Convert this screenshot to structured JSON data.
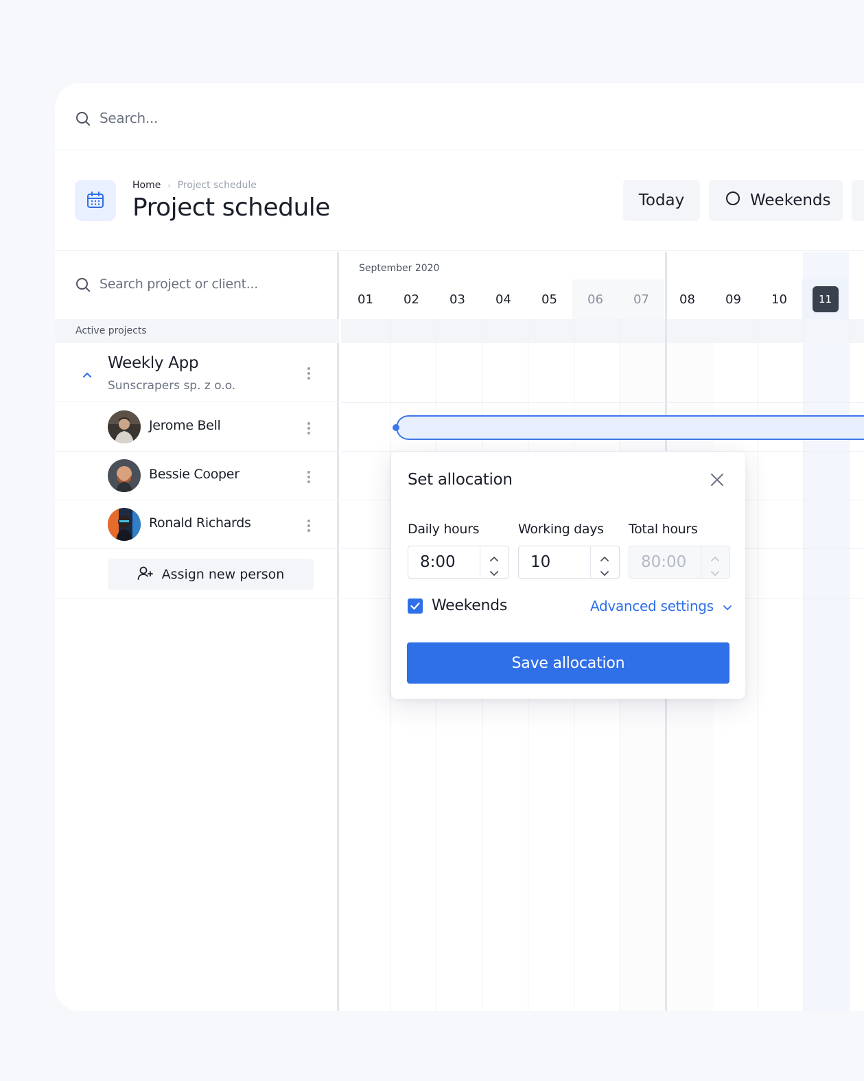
{
  "search": {
    "placeholder": "Search..."
  },
  "breadcrumb": {
    "home": "Home",
    "separator": "›",
    "current": "Project schedule"
  },
  "page": {
    "title": "Project schedule"
  },
  "header_buttons": {
    "today": "Today",
    "weekends": "Weekends"
  },
  "project_search": {
    "placeholder": "Search project or client..."
  },
  "active_projects_label": "Active projects",
  "project": {
    "name": "Weekly App",
    "client": "Sunscrapers sp. z o.o."
  },
  "people": [
    {
      "name": "Jerome Bell"
    },
    {
      "name": "Bessie Cooper"
    },
    {
      "name": "Ronald Richards"
    }
  ],
  "assign_button": "Assign new person",
  "calendar": {
    "month": "September 2020",
    "days": [
      "01",
      "02",
      "03",
      "04",
      "05",
      "06",
      "07",
      "08",
      "09",
      "10",
      "11"
    ],
    "weekend_days": [
      "06",
      "07"
    ],
    "today": "11"
  },
  "popup": {
    "title": "Set allocation",
    "daily_hours_label": "Daily hours",
    "daily_hours_value": "8:00",
    "working_days_label": "Working days",
    "working_days_value": "10",
    "total_hours_label": "Total hours",
    "total_hours_value": "80:00",
    "weekends_label": "Weekends",
    "weekends_checked": true,
    "advanced_settings": "Advanced settings",
    "save_button": "Save allocation"
  },
  "colors": {
    "accent": "#2f6fe8",
    "today_pill": "#3a414e",
    "bar_fill": "#e8f0ff",
    "bar_border": "#3e77e8"
  }
}
